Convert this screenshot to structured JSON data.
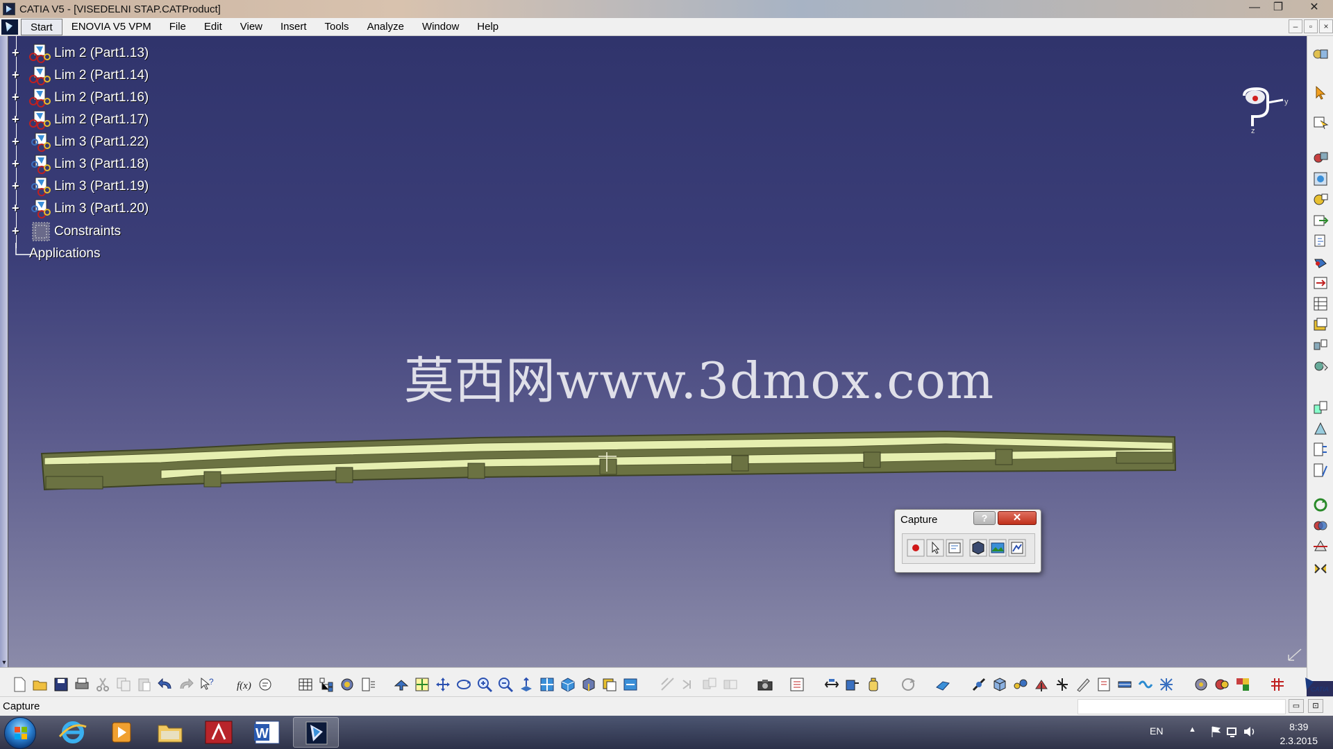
{
  "window": {
    "title": "CATIA V5 - [VISEDELNI STAP.CATProduct]",
    "minimize": "—",
    "maximize": "❐",
    "close": "✕"
  },
  "menu": {
    "items": [
      "Start",
      "ENOVIA V5 VPM",
      "File",
      "Edit",
      "View",
      "Insert",
      "Tools",
      "Analyze",
      "Window",
      "Help"
    ],
    "active": "Start",
    "mdi": [
      "–",
      "▫",
      "×"
    ]
  },
  "tree": {
    "nodes": [
      "Lim 2 (Part1.13)",
      "Lim 2 (Part1.14)",
      "Lim 2 (Part1.16)",
      "Lim 2 (Part1.17)",
      "Lim 3 (Part1.22)",
      "Lim 3 (Part1.18)",
      "Lim 3 (Part1.19)",
      "Lim 3 (Part1.20)",
      "Constraints",
      "Applications"
    ],
    "expander": "+"
  },
  "watermark": "莫西网www.3dmox.com",
  "compass": {
    "axis_y": "y",
    "axis_z": "z"
  },
  "capture_dialog": {
    "title": "Capture",
    "help": "?",
    "close": "✕",
    "tools": [
      "record-icon",
      "select-icon",
      "options-icon",
      "capture-3d-icon",
      "image-album-icon",
      "album-icon"
    ]
  },
  "status": {
    "text": "Capture",
    "buttons": [
      "▭",
      "⊡"
    ]
  },
  "taskbar": {
    "apps": [
      "ie-icon",
      "media-player-icon",
      "file-explorer-icon",
      "autocad-icon",
      "word-icon",
      "catia-icon"
    ],
    "active_app": "catia-icon",
    "language": "EN",
    "time": "8:39",
    "date": "2.3.2015"
  },
  "colors": {
    "viewport_top": "#30346c",
    "viewport_bottom": "#8b8ba9",
    "part_fill": "#e6efb0",
    "part_edge": "#6b7242",
    "capture_close": "#c0301a"
  }
}
